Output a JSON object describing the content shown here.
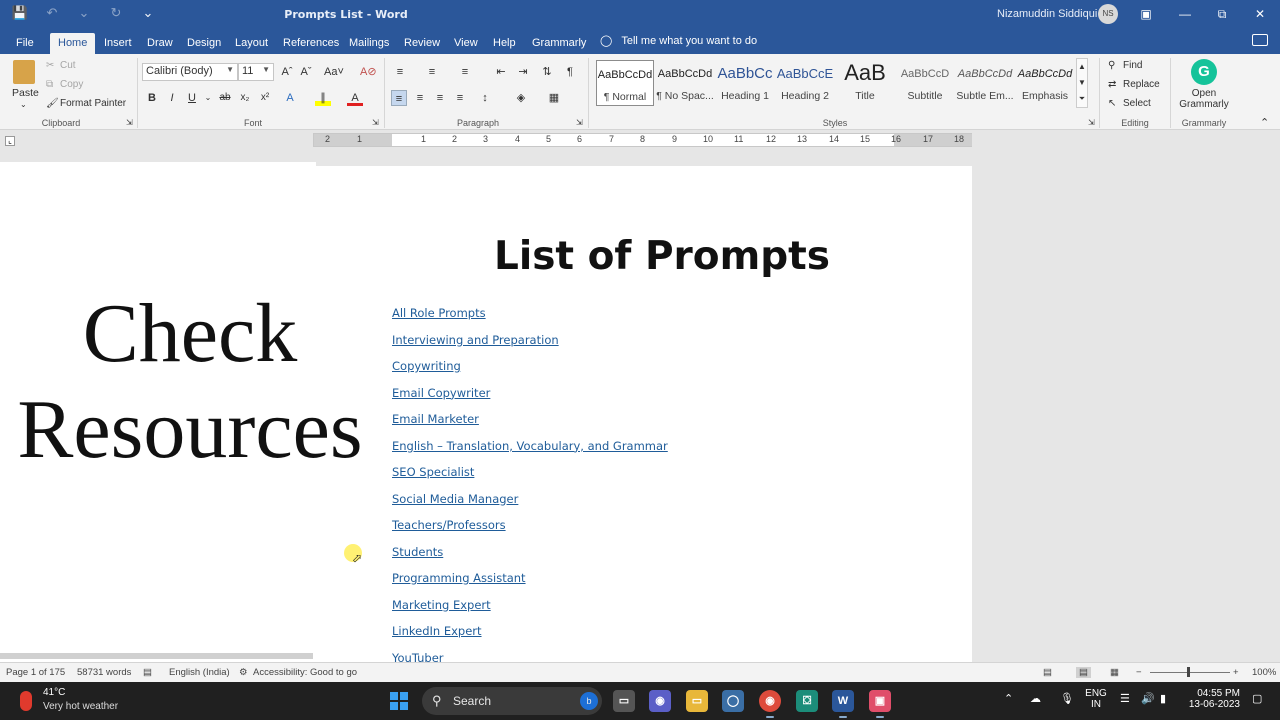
{
  "window": {
    "title": "Prompts List  -  Word",
    "user_name": "Nizamuddin Siddiqui",
    "user_initials": "NS"
  },
  "tabs": [
    "File",
    "Home",
    "Insert",
    "Draw",
    "Design",
    "Layout",
    "References",
    "Mailings",
    "Review",
    "View",
    "Help",
    "Grammarly"
  ],
  "tell_me": "Tell me what you want to do",
  "clipboard": {
    "paste": "Paste",
    "cut": "Cut",
    "copy": "Copy",
    "format_painter": "Format Painter",
    "group": "Clipboard"
  },
  "font": {
    "name": "Calibri (Body)",
    "size": "11",
    "group": "Font"
  },
  "paragraph": {
    "group": "Paragraph"
  },
  "styles": {
    "group": "Styles",
    "items": [
      {
        "preview": "AaBbCcDd",
        "name": "¶ Normal"
      },
      {
        "preview": "AaBbCcDd",
        "name": "¶ No Spac..."
      },
      {
        "preview": "AaBbCc",
        "name": "Heading 1"
      },
      {
        "preview": "AaBbCcE",
        "name": "Heading 2"
      },
      {
        "preview": "AaB",
        "name": "Title"
      },
      {
        "preview": "AaBbCcD",
        "name": "Subtitle"
      },
      {
        "preview": "AaBbCcDd",
        "name": "Subtle Em..."
      },
      {
        "preview": "AaBbCcDd",
        "name": "Emphasis"
      }
    ]
  },
  "editing": {
    "find": "Find",
    "replace": "Replace",
    "select": "Select",
    "group": "Editing"
  },
  "grammarly": {
    "open_line1": "Open",
    "open_line2": "Grammarly",
    "group": "Grammarly"
  },
  "ruler": {
    "labels": [
      "2",
      "1",
      "1",
      "2",
      "3",
      "4",
      "5",
      "6",
      "7",
      "8",
      "9",
      "10",
      "11",
      "12",
      "13",
      "14",
      "15",
      "16",
      "17",
      "18"
    ]
  },
  "document": {
    "side_text_line1": "Check",
    "side_text_line2": "Resources",
    "heading": "List of Prompts",
    "links": [
      "All Role Prompts",
      "Interviewing and Preparation",
      "Copywriting",
      "Email Copywriter",
      "Email Marketer",
      "English – Translation, Vocabulary, and Grammar",
      "SEO Specialist",
      "Social Media Manager",
      "Teachers/Professors",
      "Students",
      "Programming Assistant",
      "Marketing Expert",
      "LinkedIn Expert",
      "YouTuber"
    ]
  },
  "status": {
    "page": "Page 1 of 175",
    "words": "58731 words",
    "language": "English (India)",
    "accessibility": "Accessibility: Good to go",
    "zoom": "100%"
  },
  "taskbar": {
    "temperature": "41°C",
    "weather": "Very hot weather",
    "search": "Search",
    "lang1": "ENG",
    "lang2": "IN",
    "time": "04:55 PM",
    "date": "13-06-2023"
  }
}
